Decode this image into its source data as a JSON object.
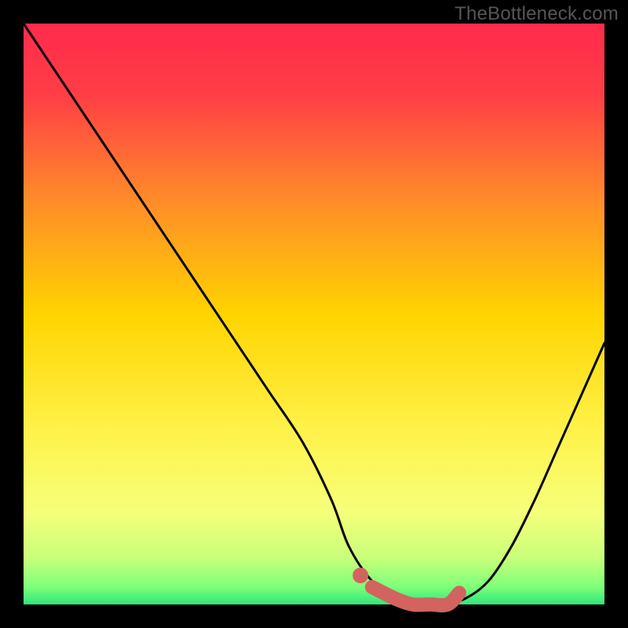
{
  "watermark": "TheBottleneck.com",
  "colors": {
    "background": "#000000",
    "gradient_top": "#ff2b4c",
    "gradient_mid": "#ffd400",
    "gradient_low": "#f6ff7a",
    "gradient_bottom": "#2fe67c",
    "curve": "#000000",
    "highlight": "#d3635e"
  },
  "chart_data": {
    "type": "line",
    "title": "",
    "xlabel": "",
    "ylabel": "",
    "xlim": [
      0,
      100
    ],
    "ylim": [
      0,
      100
    ],
    "series": [
      {
        "name": "bottleneck-curve",
        "x": [
          0,
          6,
          12,
          18,
          24,
          30,
          36,
          42,
          48,
          53,
          56,
          60,
          64,
          68,
          72,
          76,
          80,
          84,
          88,
          92,
          96,
          100
        ],
        "values": [
          100,
          91,
          82,
          73,
          64,
          55,
          46,
          37,
          28,
          18,
          10,
          4,
          1,
          0,
          0,
          1,
          4,
          10,
          18,
          27,
          36,
          45
        ]
      },
      {
        "name": "optimal-range-highlight",
        "x": [
          60,
          64,
          67,
          70,
          73,
          75
        ],
        "values": [
          3,
          1,
          0,
          0,
          0,
          2
        ]
      }
    ],
    "annotations": []
  }
}
